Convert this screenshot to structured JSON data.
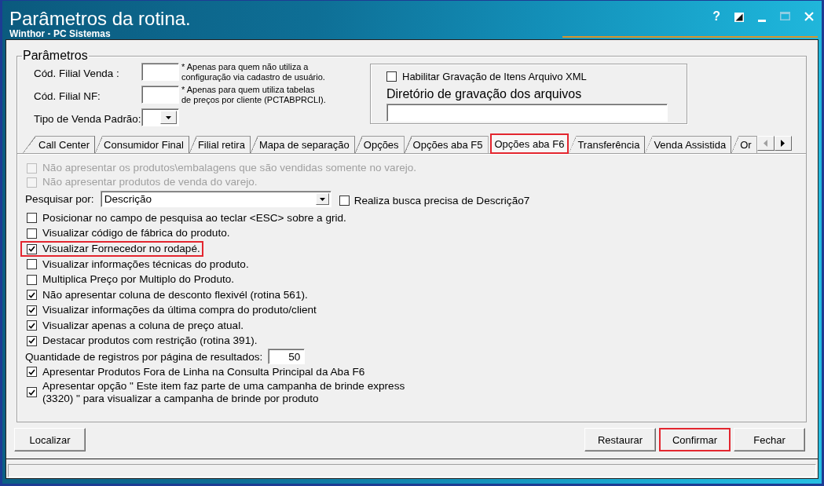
{
  "window": {
    "title": "Parâmetros da rotina.",
    "subtitle": "Winthor - PC Sistemas",
    "controls": [
      {
        "kind": "help",
        "label": "?",
        "disabled": false
      },
      {
        "kind": "contrast",
        "disabled": false
      },
      {
        "kind": "minimize",
        "disabled": false
      },
      {
        "kind": "maximize",
        "disabled": true
      },
      {
        "kind": "close",
        "disabled": false
      }
    ]
  },
  "parameters": {
    "legend": "Parâmetros",
    "fields": [
      {
        "kind": "text",
        "label": "Cód. Filial Venda :",
        "hint_lines": [
          "* Apenas para quem não utiliza a",
          "configuração via cadastro de usuário."
        ]
      },
      {
        "kind": "text",
        "label": "Cód. Filial NF:",
        "hint_lines": [
          "* Apenas para quem utiliza tabelas",
          "de preços por cliente (PCTABPRCLI)."
        ]
      },
      {
        "kind": "combo",
        "label": "Tipo de Venda Padrão:"
      }
    ],
    "xml": {
      "label": "Habilitar Gravação de Itens Arquivo XML",
      "checked": false,
      "directory_label": "Diretório de gravação dos arquivos"
    }
  },
  "tabs": [
    {
      "label": "Call Center",
      "selected": false,
      "highlighted": false
    },
    {
      "label": "Consumidor Final",
      "selected": false,
      "highlighted": false
    },
    {
      "label": "Filial retira",
      "selected": false,
      "highlighted": false
    },
    {
      "label": "Mapa de separação",
      "selected": false,
      "highlighted": false
    },
    {
      "label": "Opções",
      "selected": false,
      "highlighted": false
    },
    {
      "label": "Opções aba F5",
      "selected": false,
      "highlighted": false
    },
    {
      "label": "Opções aba F6",
      "selected": true,
      "highlighted": true
    },
    {
      "label": "Transferência",
      "selected": false,
      "highlighted": false
    },
    {
      "label": "Venda Assistida",
      "selected": false,
      "highlighted": false
    },
    {
      "label": "Or",
      "selected": false,
      "highlighted": false
    }
  ],
  "tab_scroll": [
    {
      "kind": "left",
      "disabled": true
    },
    {
      "kind": "right",
      "disabled": false
    }
  ],
  "options": [
    {
      "kind": "checkbox",
      "label": "Não apresentar os produtos\\embalagens que são vendidas somente no varejo.",
      "checked": false,
      "disabled": true,
      "highlighted": false
    },
    {
      "kind": "checkbox",
      "label": "Não apresentar produtos de venda do varejo.",
      "checked": false,
      "disabled": true,
      "highlighted": false
    },
    {
      "kind": "search",
      "label": "Pesquisar por:",
      "value": "Descrição",
      "option_label": "Realiza busca precisa de Descrição7",
      "option_checked": false,
      "disabled": false,
      "highlighted": false
    },
    {
      "kind": "checkbox",
      "label": "Posicionar no campo de pesquisa ao teclar <ESC> sobre a grid.",
      "checked": false,
      "disabled": false,
      "highlighted": false
    },
    {
      "kind": "checkbox",
      "label": "Visualizar código de fábrica do produto.",
      "checked": false,
      "disabled": false,
      "highlighted": false
    },
    {
      "kind": "checkbox",
      "label": "Visualizar Fornecedor no rodapé.",
      "checked": true,
      "disabled": false,
      "highlighted": true
    },
    {
      "kind": "checkbox",
      "label": "Visualizar informações técnicas do produto.",
      "checked": false,
      "disabled": false,
      "highlighted": false
    },
    {
      "kind": "checkbox",
      "label": "Multiplica Preço por Multiplo do Produto.",
      "checked": false,
      "disabled": false,
      "highlighted": false
    },
    {
      "kind": "checkbox",
      "label": "Não apresentar coluna de desconto flexivél (rotina 561).",
      "checked": true,
      "disabled": false,
      "highlighted": false
    },
    {
      "kind": "checkbox",
      "label": "Visualizar informações da última compra do produto/client",
      "checked": true,
      "disabled": false,
      "highlighted": false
    },
    {
      "kind": "checkbox",
      "label": "Visualizar apenas a coluna de preço atual.",
      "checked": true,
      "disabled": false,
      "highlighted": false
    },
    {
      "kind": "checkbox",
      "label": "Destacar produtos com restrição (rotina 391).",
      "checked": true,
      "disabled": false,
      "highlighted": false
    },
    {
      "kind": "number",
      "label": "Quantidade de registros por página de resultados:",
      "value": "50",
      "disabled": false,
      "highlighted": false
    },
    {
      "kind": "checkbox",
      "label": "Apresentar Produtos Fora de Linha na Consulta Principal da Aba F6",
      "checked": true,
      "disabled": false,
      "highlighted": false
    },
    {
      "kind": "checkbox",
      "label_lines": [
        "Apresentar opção \" Este item faz parte de uma campanha de brinde express",
        "(3320) \" para visualizar a campanha de brinde por produto"
      ],
      "checked": true,
      "disabled": false,
      "highlighted": false
    }
  ],
  "buttons": [
    {
      "label": "Localizar",
      "highlighted": false
    },
    {
      "label": "Restaurar",
      "highlighted": false
    },
    {
      "label": "Confirmar",
      "highlighted": true
    },
    {
      "label": "Fechar",
      "highlighted": false
    }
  ]
}
